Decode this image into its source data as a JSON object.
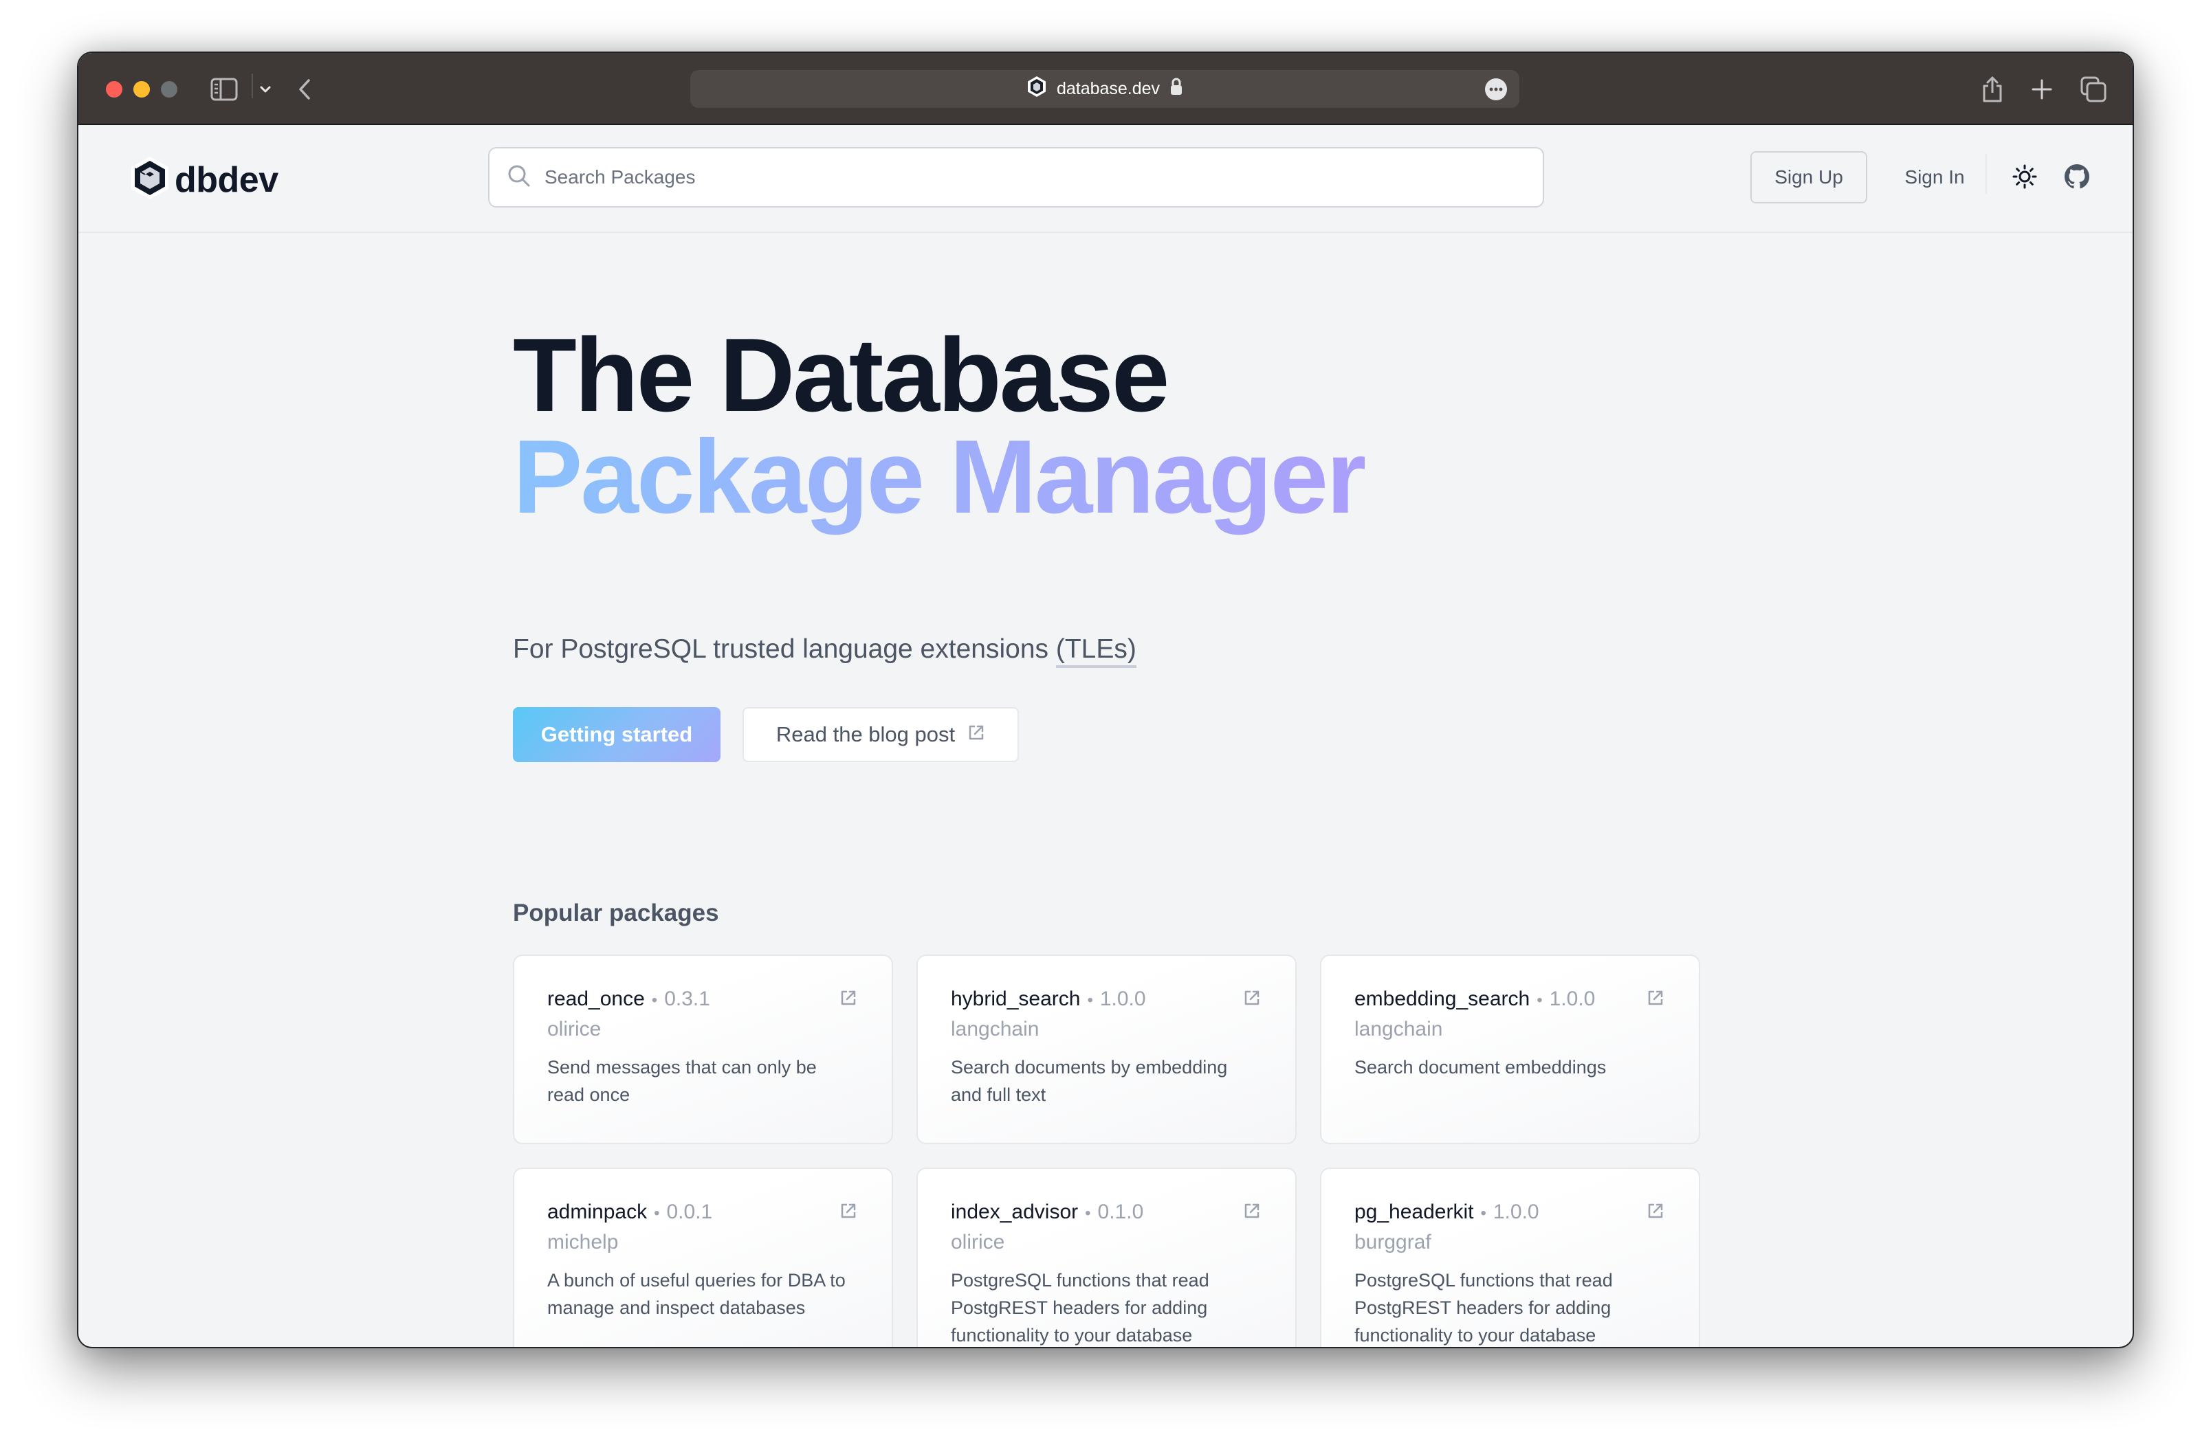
{
  "browser": {
    "url": "database.dev",
    "secure": true,
    "icons": [
      "sidebar-icon",
      "chevron-down-icon",
      "back-icon",
      "site-favicon",
      "lock-icon",
      "more-icon",
      "share-icon",
      "new-tab-icon",
      "tabs-overview-icon"
    ]
  },
  "header": {
    "logo_text": "dbdev",
    "search": {
      "placeholder": "Search Packages",
      "value": ""
    },
    "sign_up_label": "Sign Up",
    "sign_in_label": "Sign In",
    "icons": [
      "sun-icon",
      "github-icon"
    ]
  },
  "hero": {
    "title_line1": "The Database",
    "title_line2": "Package Manager",
    "subtitle_prefix": "For PostgreSQL trusted language extensions ",
    "subtitle_abbr": "(TLEs)",
    "primary_button": "Getting started",
    "secondary_button": "Read the blog post",
    "gradient_colors": [
      "#8ac2fd",
      "#ab9ffb"
    ]
  },
  "popular": {
    "title": "Popular packages",
    "packages": [
      {
        "name": "read_once",
        "version": "0.3.1",
        "author": "olirice",
        "description": "Send messages that can only be read once"
      },
      {
        "name": "hybrid_search",
        "version": "1.0.0",
        "author": "langchain",
        "description": "Search documents by embedding and full text"
      },
      {
        "name": "embedding_search",
        "version": "1.0.0",
        "author": "langchain",
        "description": "Search document embeddings"
      },
      {
        "name": "adminpack",
        "version": "0.0.1",
        "author": "michelp",
        "description": "A bunch of useful queries for DBA to manage and inspect databases"
      },
      {
        "name": "index_advisor",
        "version": "0.1.0",
        "author": "olirice",
        "description": "PostgreSQL functions that read PostgREST headers for adding functionality to your database"
      },
      {
        "name": "pg_headerkit",
        "version": "1.0.0",
        "author": "burggraf",
        "description": "PostgreSQL functions that read PostgREST headers for adding functionality to your database"
      }
    ],
    "separator": "•"
  }
}
